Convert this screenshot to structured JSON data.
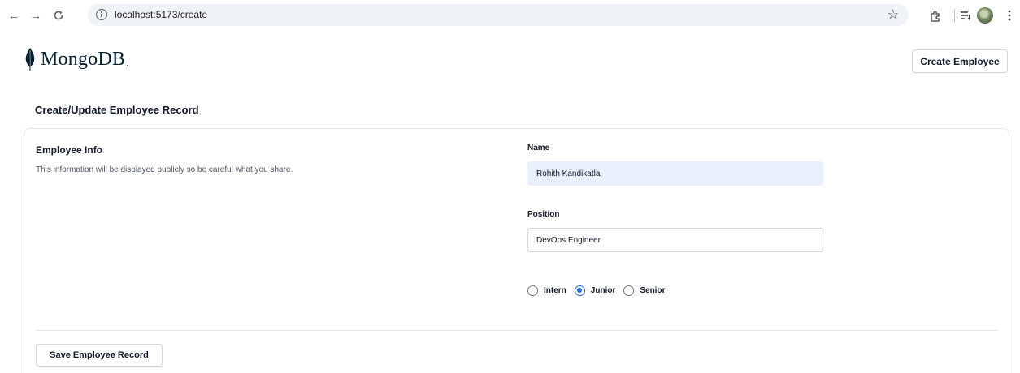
{
  "browser": {
    "url": "localhost:5173/create",
    "icons": [
      "back-icon",
      "forward-icon",
      "reload-icon",
      "site-info-icon",
      "bookmark-star-icon",
      "extensions-icon",
      "reading-list-icon",
      "profile-avatar",
      "more-menu-icon"
    ]
  },
  "header": {
    "logo_text": "MongoDB",
    "logo_dot": ".",
    "create_button": "Create Employee",
    "brand_color": "#00684a"
  },
  "page": {
    "title": "Create/Update Employee Record"
  },
  "form": {
    "section_title": "Employee Info",
    "section_description": "This information will be displayed publicly so be careful what you share.",
    "name_label": "Name",
    "name_value": "Rohith Kandikatla",
    "position_label": "Position",
    "position_value": "DevOps Engineer",
    "levels": [
      {
        "label": "Intern",
        "checked": false
      },
      {
        "label": "Junior",
        "checked": true
      },
      {
        "label": "Senior",
        "checked": false
      }
    ],
    "accent_color": "#2563eb",
    "autofill_color": "#e8f0fe",
    "save_button": "Save Employee Record"
  }
}
